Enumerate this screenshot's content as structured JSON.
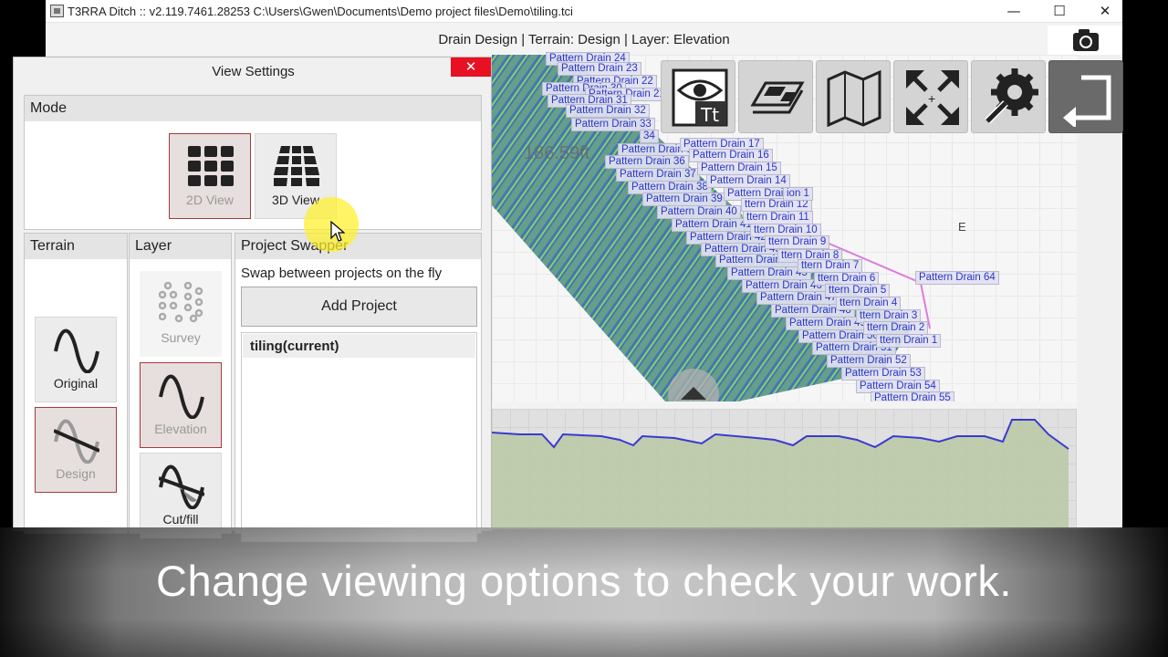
{
  "window": {
    "title": "T3RRA Ditch :: v2.119.7461.28253 C:\\Users\\Gwen\\Documents\\Demo project files\\Demo\\tiling.tci",
    "minimize": "—",
    "maximize": "☐",
    "close": "✕"
  },
  "header": {
    "title": "Drain Design | Terrain: Design | Layer: Elevation"
  },
  "dialog": {
    "title": "View Settings",
    "close": "✕",
    "mode": {
      "header": "Mode",
      "buttons": [
        {
          "label": "2D View",
          "icon": "grid-2d-icon",
          "selected": true
        },
        {
          "label": "3D View",
          "icon": "grid-3d-icon",
          "selected": false
        }
      ]
    },
    "terrain": {
      "header": "Terrain",
      "buttons": [
        {
          "label": "Original",
          "icon": "sine-wave-icon",
          "selected": false
        },
        {
          "label": "Design",
          "icon": "sine-design-icon",
          "selected": true
        }
      ]
    },
    "layer": {
      "header": "Layer",
      "buttons": [
        {
          "label": "Survey",
          "icon": "survey-dots-icon",
          "selected": false,
          "disabled": true
        },
        {
          "label": "Elevation",
          "icon": "sine-wave-icon",
          "selected": true
        },
        {
          "label": "Cut/fill",
          "icon": "cut-fill-icon",
          "selected": false
        }
      ]
    },
    "swapper": {
      "header": "Project Swapper",
      "description": "Swap between projects on the fly",
      "add_button": "Add Project",
      "projects": [
        "tiling(current)"
      ]
    }
  },
  "map": {
    "east_label": "E",
    "readout": "186.59ft",
    "toolbar": [
      "eye-text-icon",
      "layers-icon",
      "map-icon",
      "expand-icon",
      "settings-wrench-icon",
      "exit-icon"
    ],
    "drain_labels_left": [
      "Pattern Drain 24",
      "Pattern Drain 23",
      "Pattern Drain 22",
      "Pattern Drain 30",
      "Pattern Drain 21",
      "Pattern Drain 31",
      "Pattern Drain 32",
      "Pattern Drain 33",
      "34",
      "Pattern Drain 35",
      "Pattern Drain 36",
      "Pattern Drain 37",
      "Pattern Drain 38",
      "Pattern Drain 39",
      "Pattern Drain 40",
      "Pattern Drain 41",
      "Pattern Drain 42",
      "Pattern Drain 43",
      "Pattern Drain 44",
      "Pattern Drain 45",
      "Pattern Drain 46",
      "Pattern Drain 47",
      "Pattern Drain 48",
      "Pattern Drain 49",
      "Pattern Drain 50",
      "Pattern Drain 51",
      "Pattern Drain 52",
      "Pattern Drain 53",
      "Pattern Drain 54",
      "Pattern Drain 55"
    ],
    "drain_labels_right": [
      "Pattern Drain 17",
      "Pattern Drain 16",
      "Pattern Drain 15",
      "Pattern Drain 14",
      "Pattern Drain 13",
      "ttern Drain 12",
      "ttern Drain 11",
      "ttern Drain 10",
      "ttern Drain 9",
      "ttern Drain 8",
      "ttern Drain 7",
      "ttern Drain 6",
      "ttern Drain 5",
      "ttern Drain 4",
      "ttern Drain 3",
      "ttern Drain 2",
      "ttern Drain 1",
      "Pattern Drain 64",
      "ion 1"
    ]
  },
  "caption": "Change viewing options to check your work.",
  "colors": {
    "selected_border": "#a33a3a",
    "drain_label": "#2b36c8",
    "close_red": "#e81123",
    "profile_fill": "#b8c8a3",
    "profile_line": "#3a3ad0"
  }
}
